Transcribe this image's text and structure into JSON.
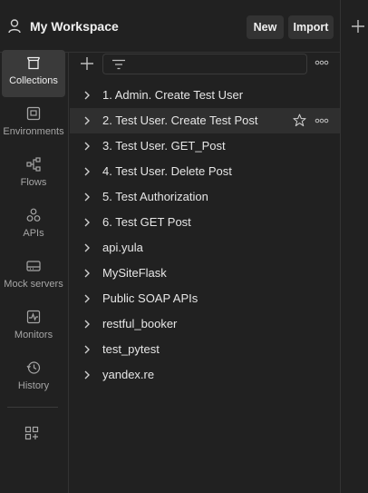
{
  "header": {
    "workspace_title": "My Workspace",
    "new_label": "New",
    "import_label": "Import"
  },
  "sidebar": {
    "items": [
      {
        "label": "Collections",
        "icon": "collections-icon",
        "active": true
      },
      {
        "label": "Environments",
        "icon": "environments-icon"
      },
      {
        "label": "Flows",
        "icon": "flows-icon"
      },
      {
        "label": "APIs",
        "icon": "apis-icon"
      },
      {
        "label": "Mock servers",
        "icon": "mock-servers-icon"
      },
      {
        "label": "Monitors",
        "icon": "monitors-icon"
      },
      {
        "label": "History",
        "icon": "history-icon"
      }
    ]
  },
  "collections": [
    "1. Admin. Create Test User",
    "2. Test User. Create Test Post",
    "3. Test User. GET_Post",
    "4. Test User. Delete Post",
    "5. Test Authorization",
    "6. Test GET Post",
    "api.yula",
    "MySiteFlask",
    "Public SOAP APIs",
    "restful_booker",
    "test_pytest",
    "yandex.re"
  ],
  "colors": {
    "background": "#212121",
    "active_nav": "#3a3a3a",
    "hover_row": "#2f2f2f",
    "text": "#e6e6e6",
    "muted": "#a6a6a6"
  }
}
